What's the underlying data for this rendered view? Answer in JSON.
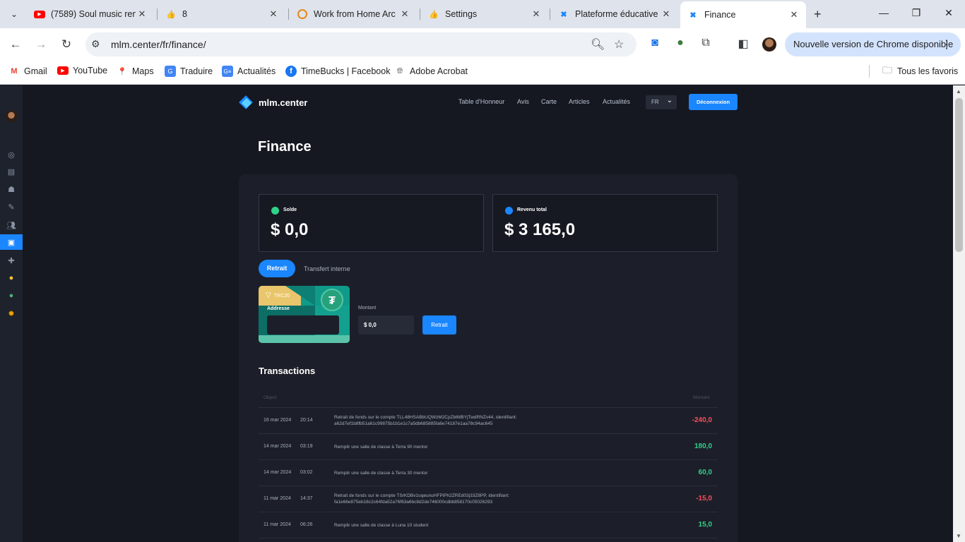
{
  "browser": {
    "tabs": [
      {
        "title": "(7589) Soul music ren",
        "icon": "youtube-icon"
      },
      {
        "title": "8",
        "icon": "thumbs-icon"
      },
      {
        "title": "Work from Home Arc",
        "icon": "spinner-icon"
      },
      {
        "title": "Settings",
        "icon": "thumbs-icon"
      },
      {
        "title": "Plateforme éducative",
        "icon": "mlm-icon"
      },
      {
        "title": "Finance",
        "icon": "mlm-icon"
      }
    ],
    "url": "mlm.center/fr/finance/",
    "update_label": "Nouvelle version de Chrome disponible",
    "bookmarks": [
      "Gmail",
      "YouTube",
      "Maps",
      "Traduire",
      "Actualités",
      "TimeBucks | Facebook",
      "Adobe Acrobat"
    ],
    "all_bookmarks": "Tous les favoris"
  },
  "site": {
    "logo": "mlm.center",
    "nav": [
      "Table d'Honneur",
      "Avis",
      "Carte",
      "Articles",
      "Actualités"
    ],
    "lang": "FR",
    "logout": "Déconnexion"
  },
  "page": {
    "title": "Finance",
    "balance_label": "Solde",
    "balance_value": "$ 0,0",
    "income_label": "Revenu total",
    "income_value": "$ 3 165,0",
    "tab_withdraw": "Retrait",
    "tab_transfer": "Transfert interne",
    "card_network": "TRC20",
    "card_address_label": "Addresse",
    "amount_label": "Montant",
    "amount_value": "$ 0,0",
    "withdraw_button": "Retrait",
    "transactions_title": "Transactions",
    "col_object": "Object",
    "col_amount": "Montant",
    "transactions": [
      {
        "date": "16 mar 2024",
        "time": "20:14",
        "desc": "Retrait de fonds sur le compte TLL48HSABbUQWzM2CpZbtMBYjTwdRNZv44, identifiant: a62d7ef1b8fb51a61c99875b1b1e1c7a5db685885fa6e74187e1aa78c94ac645",
        "amount": "-240,0",
        "type": "debit"
      },
      {
        "date": "14 mar 2024",
        "time": "03:19",
        "desc": "Remplir une salle de classe à Terra 90 mentor",
        "amount": "180,0",
        "type": "credit"
      },
      {
        "date": "14 mar 2024",
        "time": "03:02",
        "desc": "Remplir une salle de classe à Terra 30 mentor",
        "amount": "60,0",
        "type": "credit"
      },
      {
        "date": "11 mar 2024",
        "time": "14:37",
        "desc": "Retrait de fonds sur le compte TSrKDBv1oqeunuHFPiPh2ZREd03j33Z8PP, identifiant: fa1e66e875eb18c2c64fda52a76f63a6bc8d2de746000cdbb858170c05026293",
        "amount": "-15,0",
        "type": "debit"
      },
      {
        "date": "11 mar 2024",
        "time": "06:26",
        "desc": "Remplir une salle de classe à Luna 10 student",
        "amount": "15,0",
        "type": "credit"
      }
    ]
  },
  "colors": {
    "accent": "#1a86ff",
    "credit": "#2fd28a",
    "debit": "#ff4d5a",
    "background": "#151821"
  }
}
